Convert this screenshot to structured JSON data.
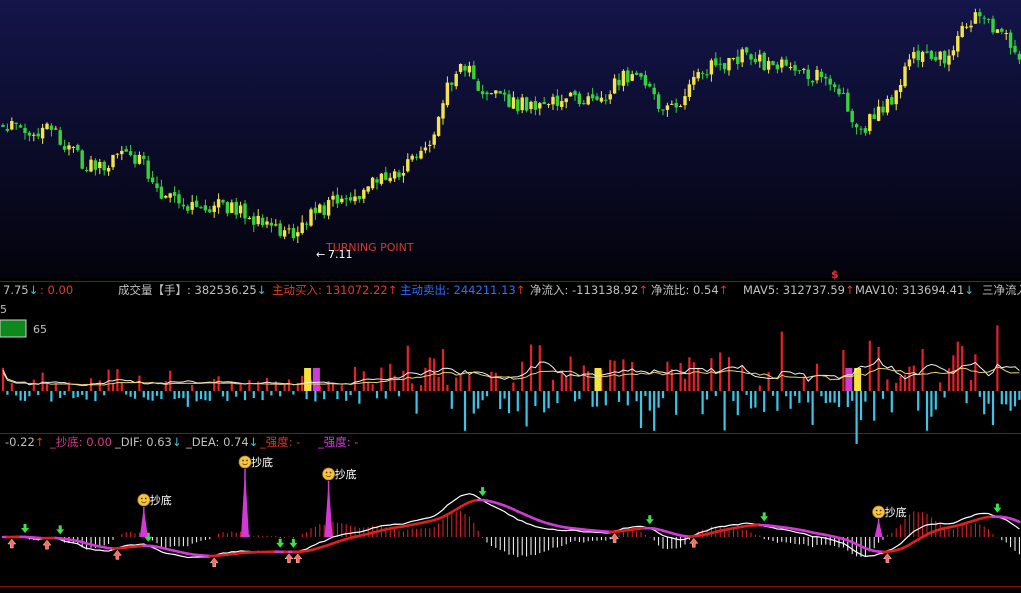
{
  "main_panel": {
    "annotation_text": "TURNING POINT",
    "low_label": "7.11",
    "signal_marker": "$"
  },
  "volume_panel": {
    "info_items": [
      {
        "id": "v0",
        "text": "7.75",
        "arrow": "down",
        "color": "#c0c0c0"
      },
      {
        "id": "v1",
        "text": ": 0.00",
        "arrow": "",
        "color": "#d83a2e"
      },
      {
        "id": "v2",
        "text": "成交量【手】: 382536.25",
        "arrow": "down",
        "color": "#c0c0c0"
      },
      {
        "id": "v3",
        "text": "主动买入: 131072.22",
        "arrow": "up",
        "color": "#e03b2f"
      },
      {
        "id": "v4",
        "text": "主动卖出: 244211.13",
        "arrow": "up",
        "color": "#2f6bff"
      },
      {
        "id": "v5",
        "text": "净流入: -113138.92",
        "arrow": "up",
        "color": "#c0c0c0"
      },
      {
        "id": "v6",
        "text": "净流比: 0.54",
        "arrow": "up",
        "color": "#c0c0c0"
      },
      {
        "id": "v7",
        "text": "MAV5: 312737.59",
        "arrow": "up",
        "color": "#c0c0c0"
      },
      {
        "id": "v8",
        "text": "MAV10: 313694.41",
        "arrow": "down",
        "color": "#c0c0c0"
      },
      {
        "id": "v9",
        "text": "三净流入",
        "arrow": "",
        "color": "#c0c0c0"
      }
    ],
    "left_digit": "5",
    "box_value": "65"
  },
  "macd_panel": {
    "info_items": [
      {
        "id": "m0",
        "text": "-0.22",
        "arrow": "up",
        "color": "#c0c0c0"
      },
      {
        "id": "m1",
        "text": "_抄底: 0.00",
        "arrow": "",
        "color": "#d83a8a"
      },
      {
        "id": "m2",
        "text": "_DIF: 0.63",
        "arrow": "down",
        "color": "#c0c0c0"
      },
      {
        "id": "m3",
        "text": "_DEA: 0.74",
        "arrow": "down",
        "color": "#c0c0c0"
      },
      {
        "id": "m4",
        "text": "_强度: -",
        "arrow": "",
        "color": "#d83a2e"
      },
      {
        "id": "m5",
        "text": "_强度: -",
        "arrow": "",
        "color": "#d83adf"
      }
    ],
    "bottom_signal_label": "抄底",
    "bottom_signals": [
      {
        "id": "b0",
        "index": 32
      },
      {
        "id": "b1",
        "index": 55
      },
      {
        "id": "b2",
        "index": 74
      },
      {
        "id": "b3",
        "index": 199
      }
    ]
  },
  "colors": {
    "up_candle": "#f2e44a",
    "down_candle": "#35d33a",
    "vol_up": "#e8202a",
    "vol_down": "#39c6e8",
    "dif_line": "#ffffff",
    "dea_line": "#e02020",
    "dea_line_alt": "#d23ad8",
    "macd_up": "#e8202a",
    "macd_down": "#ffffff",
    "signal_stick": "#d23ad8",
    "grid": "#7a1010"
  },
  "chart_data": {
    "type": "candlestick",
    "anchors": [
      [
        0,
        -3.8
      ],
      [
        10,
        -4.4
      ],
      [
        20,
        -7.6
      ],
      [
        30,
        -6.8
      ],
      [
        36,
        -10.6
      ],
      [
        40,
        -11.4
      ],
      [
        50,
        -11.6
      ],
      [
        58,
        -12.8
      ],
      [
        66,
        -14.2
      ],
      [
        70,
        -12.4
      ],
      [
        76,
        -11.2
      ],
      [
        86,
        -9.2
      ],
      [
        94,
        -7.0
      ],
      [
        104,
        1.6
      ],
      [
        112,
        -1.2
      ],
      [
        120,
        -2.0
      ],
      [
        128,
        -1.4
      ],
      [
        134,
        -1.8
      ],
      [
        142,
        0.9
      ],
      [
        152,
        -2.2
      ],
      [
        160,
        1.6
      ],
      [
        168,
        2.8
      ],
      [
        176,
        1.8
      ],
      [
        184,
        1.0
      ],
      [
        190,
        -0.6
      ],
      [
        194,
        -4.6
      ],
      [
        200,
        -2.2
      ],
      [
        208,
        3.0
      ],
      [
        214,
        2.6
      ],
      [
        218,
        5.6
      ],
      [
        222,
        6.8
      ],
      [
        228,
        4.8
      ],
      [
        231,
        3.0
      ]
    ],
    "low_value": 7.11,
    "low_index": 70,
    "signal_index": 190
  }
}
